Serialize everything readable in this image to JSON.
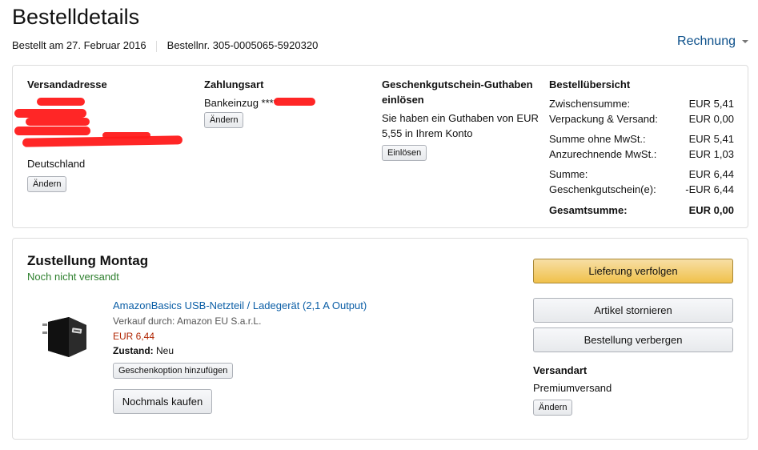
{
  "page": {
    "title": "Bestelldetails",
    "ordered_on": "Bestellt am 27. Februar 2016",
    "order_number": "Bestellnr. 305-0005065-5920320",
    "invoice_link": "Rechnung"
  },
  "shipping_address": {
    "heading": "Versandadresse",
    "country": "Deutschland",
    "change_button": "Ändern"
  },
  "payment": {
    "heading": "Zahlungsart",
    "method": "Bankeinzug ****",
    "change_button": "Ändern"
  },
  "gift_card": {
    "heading_line1": "Geschenkgutschein-Guthaben",
    "heading_line2": "einlösen",
    "balance_line1": "Sie haben ein Guthaben von EUR",
    "balance_line2": "5,55 in Ihrem Konto",
    "redeem_button": "Einlösen"
  },
  "summary": {
    "heading": "Bestellübersicht",
    "rows": [
      {
        "label": "Zwischensumme:",
        "value": "EUR 5,41"
      },
      {
        "label": "Verpackung & Versand:",
        "value": "EUR 0,00"
      },
      {
        "label": "Summe ohne MwSt.:",
        "value": "EUR 5,41"
      },
      {
        "label": "Anzurechnende MwSt.:",
        "value": "EUR 1,03"
      },
      {
        "label": "Summe:",
        "value": "EUR 6,44"
      },
      {
        "label": "Geschenkgutschein(e):",
        "value": "-EUR 6,44"
      }
    ],
    "total_label": "Gesamtsumme:",
    "total_value": "EUR 0,00"
  },
  "shipment": {
    "heading": "Zustellung Montag",
    "status": "Noch nicht versandt",
    "status_color": "#2d7f2d",
    "item": {
      "title": "AmazonBasics USB-Netzteil / Ladegerät (2,1 A Output)",
      "seller": "Verkauf durch: Amazon EU S.a.r.L.",
      "price": "EUR 6,44",
      "condition_label": "Zustand:",
      "condition_value": "Neu",
      "gift_button": "Geschenkoption hinzufügen",
      "buy_again_button": "Nochmals kaufen"
    },
    "track_button": "Lieferung verfolgen",
    "cancel_button": "Artikel stornieren",
    "hide_button": "Bestellung verbergen",
    "shipping_type_heading": "Versandart",
    "shipping_type": "Premiumversand",
    "change_button": "Ändern"
  }
}
